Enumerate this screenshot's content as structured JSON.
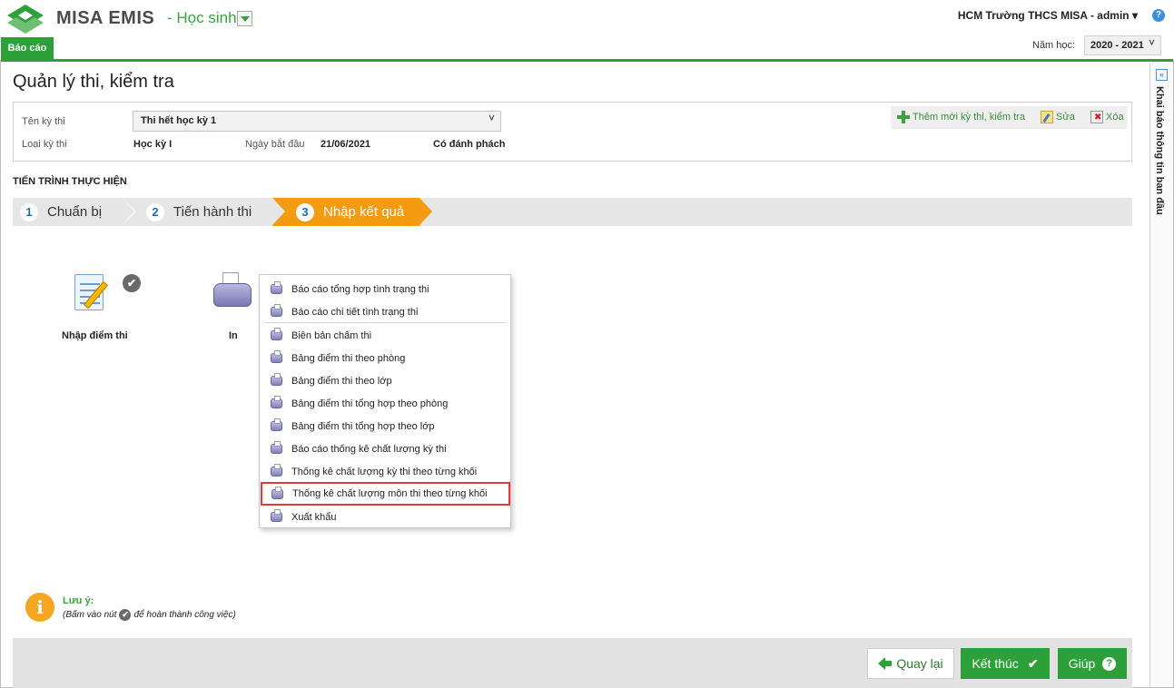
{
  "header": {
    "brand": "MISA EMIS",
    "module": "- Học sinh",
    "user": "HCM Trường THCS MISA - admin ▾",
    "report_tab": "Báo cáo",
    "year_label": "Năm học:",
    "year_value": "2020 - 2021"
  },
  "side_panel": {
    "title": "Khai báo thông tin ban đầu"
  },
  "page": {
    "title": "Quản lý thi, kiểm tra"
  },
  "info": {
    "exam_name_label": "Tên kỳ thi",
    "exam_name_value": "Thi hết học kỳ 1",
    "exam_type_label": "Loại kỳ thi",
    "exam_type_value": "Học kỳ I",
    "start_date_label": "Ngày bắt đầu",
    "start_date_value": "21/06/2021",
    "option_value": "Có đánh phách"
  },
  "actions": {
    "add": "Thêm mới kỳ thi, kiểm tra",
    "edit": "Sửa",
    "delete": "Xóa"
  },
  "process": {
    "label": "TIẾN TRÌNH THỰC HIỆN",
    "steps": [
      {
        "num": "1",
        "label": "Chuẩn bị"
      },
      {
        "num": "2",
        "label": "Tiến hành thi"
      },
      {
        "num": "3",
        "label": "Nhập kết quả"
      }
    ],
    "active_color": "#f39c12"
  },
  "tasks": {
    "score_entry": "Nhập điểm thi",
    "print": "In"
  },
  "print_menu": {
    "items": [
      "Báo cáo tổng hợp tình trạng thi",
      "Báo cáo chi tiết tình trạng thi",
      "Biên bản chấm thi",
      "Bảng điểm thi theo phòng",
      "Bảng điểm thi theo lớp",
      "Bảng điểm thi tổng hợp theo phòng",
      "Bảng điểm thi tổng hợp theo lớp",
      "Báo cáo thống kê chất lượng kỳ thi",
      "Thống kê chất lượng kỳ thi theo từng khối",
      "Thống kê chất lượng môn thi theo từng khối",
      "Xuất khẩu"
    ],
    "highlighted": "Thống kê chất lượng môn thi theo từng khối"
  },
  "note": {
    "title": "Lưu ý:",
    "text_before": "(Bấm vào nút",
    "text_after": "để hoàn thành công việc)"
  },
  "footer": {
    "back": "Quay lại",
    "finish": "Kết thúc",
    "help": "Giúp"
  },
  "colors": {
    "brand_green": "#2da03a",
    "accent_orange": "#f39c12",
    "highlight_red": "#e23a3a"
  }
}
